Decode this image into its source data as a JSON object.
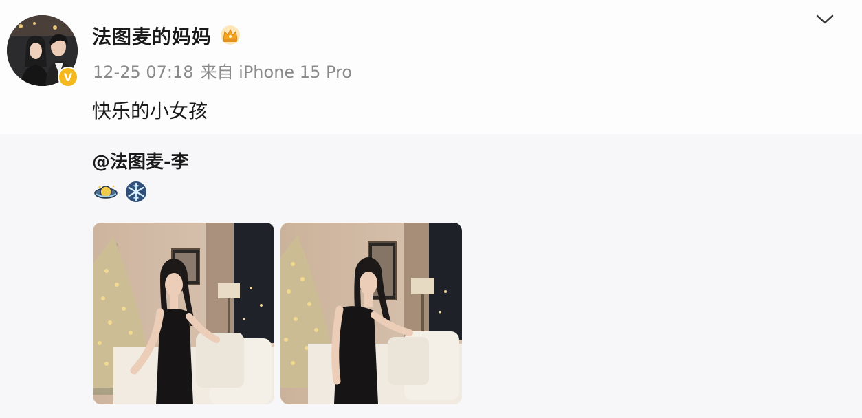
{
  "post": {
    "author": "法图麦的妈妈",
    "timestamp": "12-25 07:18",
    "source": "来自 iPhone 15 Pro",
    "text": "快乐的小女孩",
    "mention": "@法图麦-李",
    "verified_badge": "V",
    "emojis": [
      "planet-emoji",
      "snowflake-emoji"
    ],
    "photo_count": 2
  },
  "icons": {
    "crown": "crown-icon",
    "menu": "chevron-down-icon"
  },
  "colors": {
    "meta_text": "#8a8a8a",
    "badge": "#f5b81d",
    "crown": "#f3a51f"
  }
}
